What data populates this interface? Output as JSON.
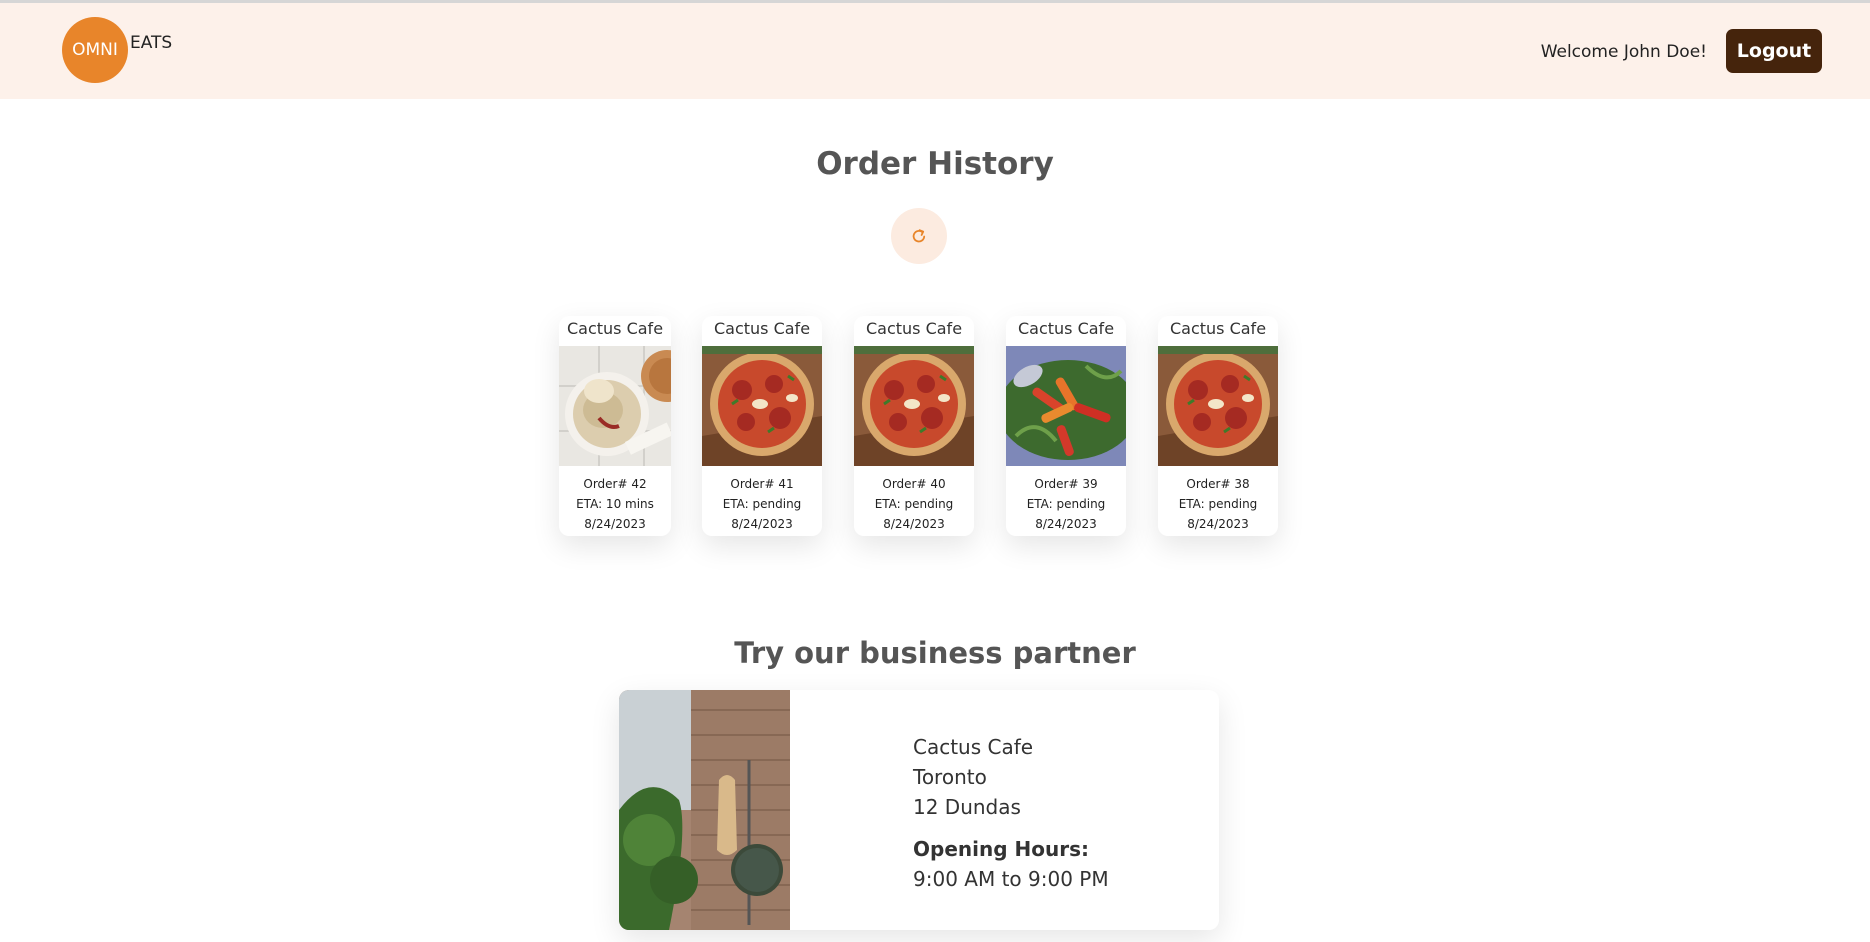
{
  "header": {
    "logo_circle": "OMNI",
    "logo_text": "EATS",
    "welcome": "Welcome John Doe!",
    "logout_label": "Logout"
  },
  "order_history": {
    "title": "Order History",
    "refresh_icon": "refresh-icon",
    "orders": [
      {
        "restaurant": "Cactus Cafe",
        "order": "Order# 42",
        "eta": "ETA: 10 mins",
        "date": "8/24/2023",
        "image": "hummus-bowl"
      },
      {
        "restaurant": "Cactus Cafe",
        "order": "Order# 41",
        "eta": "ETA: pending",
        "date": "8/24/2023",
        "image": "pizza"
      },
      {
        "restaurant": "Cactus Cafe",
        "order": "Order# 40",
        "eta": "ETA: pending",
        "date": "8/24/2023",
        "image": "pizza"
      },
      {
        "restaurant": "Cactus Cafe",
        "order": "Order# 39",
        "eta": "ETA: pending",
        "date": "8/24/2023",
        "image": "roasted-vegetables"
      },
      {
        "restaurant": "Cactus Cafe",
        "order": "Order# 38",
        "eta": "ETA: pending",
        "date": "8/24/2023",
        "image": "pizza"
      }
    ]
  },
  "partner": {
    "title": "Try our business partner",
    "name": "Cactus Cafe",
    "city": "Toronto",
    "address": "12 Dundas",
    "hours_label": "Opening Hours:",
    "hours": "9:00 AM to 9:00 PM",
    "image": "storefront-sign"
  },
  "colors": {
    "header_bg": "#fdf1ea",
    "logo_orange": "#e8852a",
    "logout_bg": "#45240c",
    "refresh_bg": "#fcebe0"
  }
}
